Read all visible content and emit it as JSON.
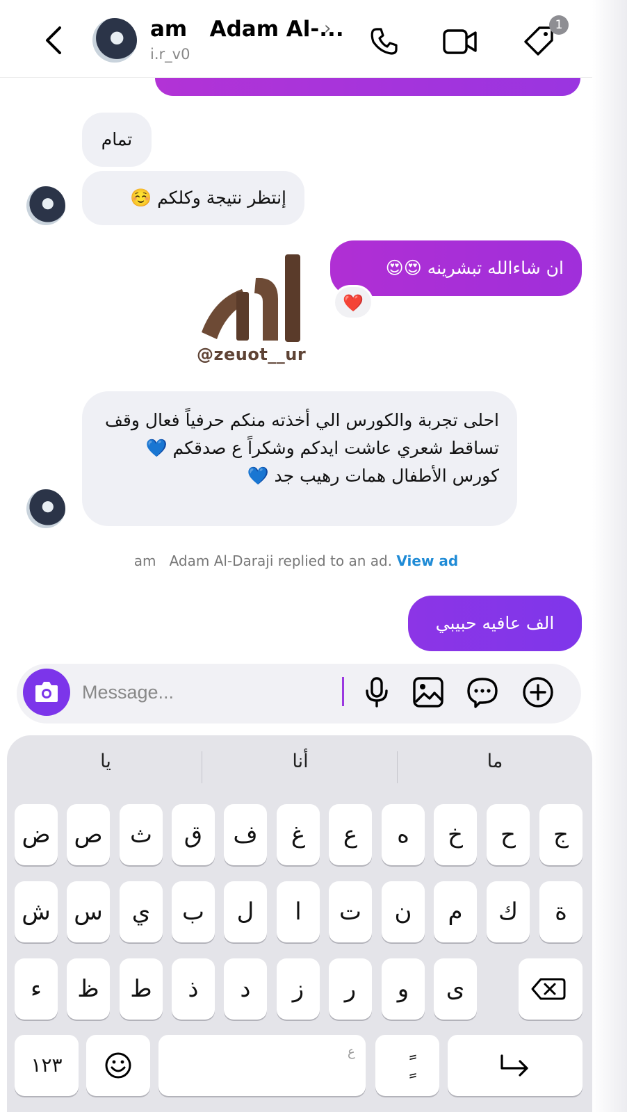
{
  "header": {
    "contact_name": "am   Adam Al-...",
    "username": "i.r_v0",
    "notification_count": "1"
  },
  "messages": [
    {
      "side": "incoming",
      "text": "تمام"
    },
    {
      "side": "incoming",
      "text": "إنتظر نتيجة وكلكم ☺️"
    },
    {
      "side": "outgoing",
      "text": "ان شاءالله تبشرينه 😍😍",
      "reaction": "❤️"
    },
    {
      "side": "incoming",
      "type": "sticker",
      "logo_text": "@zeuot__ur"
    },
    {
      "side": "incoming",
      "text": "احلى تجربة والكورس الي أخذته منكم حرفياً فعال وقف تساقط شعري عاشت ايدكم وشكراً ع صدقكم 💙 كورس الأطفال همات رهيب جد 💙"
    },
    {
      "side": "outgoing",
      "text": "الف عافيه حبيبي"
    }
  ],
  "ad_note": {
    "text": "am   Adam Al-Daraji replied to an ad. ",
    "link": "View ad"
  },
  "composer": {
    "placeholder": "Message..."
  },
  "keyboard": {
    "suggestions": [
      "ما",
      "أنا",
      "يا"
    ],
    "row1": [
      "ج",
      "ح",
      "خ",
      "ه",
      "ع",
      "غ",
      "ف",
      "ق",
      "ث",
      "ص",
      "ض"
    ],
    "row2": [
      "ة",
      "ك",
      "م",
      "ن",
      "ت",
      "ا",
      "ل",
      "ب",
      "ي",
      "س",
      "ش"
    ],
    "row3": [
      "ى",
      "و",
      "ر",
      "ز",
      "د",
      "ذ",
      "ط",
      "ظ",
      "ء"
    ],
    "numbers_key": "١٢٣",
    "space_hint": "ع",
    "tanween_key": "ًٍ"
  }
}
